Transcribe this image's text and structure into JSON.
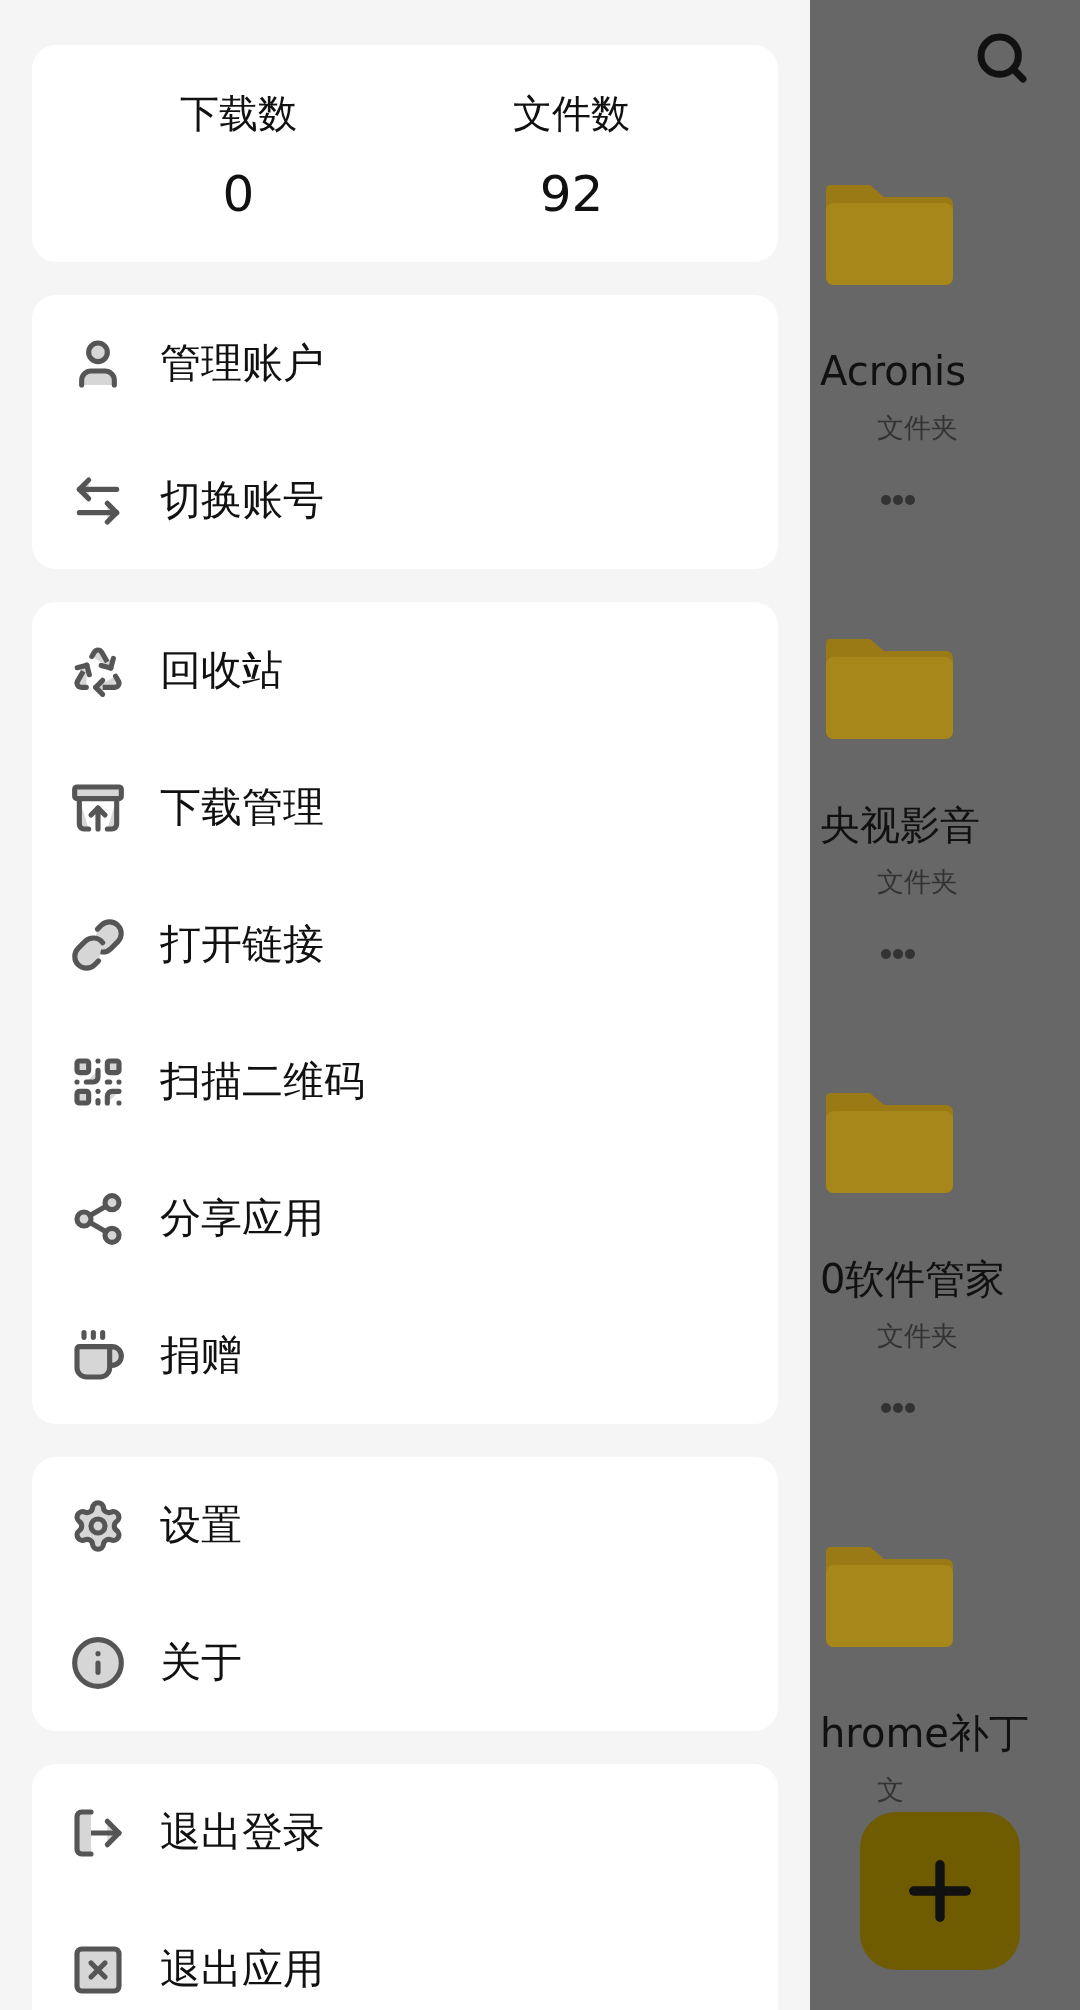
{
  "drawer": {
    "stats": [
      {
        "label": "下载数",
        "value": "0"
      },
      {
        "label": "文件数",
        "value": "92"
      }
    ],
    "groups": [
      [
        {
          "kind": "account",
          "label": "管理账户"
        },
        {
          "kind": "switch",
          "label": "切换账号"
        }
      ],
      [
        {
          "kind": "recycle",
          "label": "回收站"
        },
        {
          "kind": "download",
          "label": "下载管理"
        },
        {
          "kind": "link",
          "label": "打开链接"
        },
        {
          "kind": "qrcode",
          "label": "扫描二维码"
        },
        {
          "kind": "share",
          "label": "分享应用"
        },
        {
          "kind": "donate",
          "label": "捐赠"
        }
      ],
      [
        {
          "kind": "settings",
          "label": "设置"
        },
        {
          "kind": "about",
          "label": "关于"
        }
      ],
      [
        {
          "kind": "logout",
          "label": "退出登录"
        },
        {
          "kind": "exit",
          "label": "退出应用"
        }
      ]
    ]
  },
  "folders": [
    {
      "name": "Acronis",
      "type": "文件夹"
    },
    {
      "name": "央视影音",
      "type": "文件夹"
    },
    {
      "name": "0软件管家",
      "type": "文件夹"
    },
    {
      "name": "hrome补丁",
      "type": "文"
    }
  ]
}
